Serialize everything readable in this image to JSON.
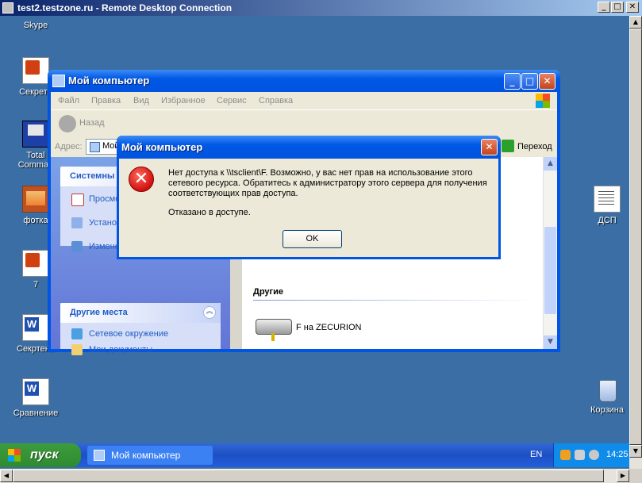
{
  "rdc": {
    "title": "test2.testzone.ru - Remote Desktop Connection",
    "min": "_",
    "max": "□",
    "close": "✕"
  },
  "desktop_icons": [
    {
      "label": "Skype"
    },
    {
      "label": "Секретн"
    },
    {
      "label": "Total Comman"
    },
    {
      "label": "фотка"
    },
    {
      "label": "7"
    },
    {
      "label": "Секртено"
    },
    {
      "label": "Сравнение"
    },
    {
      "label": "ДСП"
    },
    {
      "label": "Корзина"
    }
  ],
  "explorer": {
    "title": "Мой компьютер",
    "menu": [
      "Файл",
      "Правка",
      "Вид",
      "Избранное",
      "Сервис",
      "Справка"
    ],
    "back_label": "Назад",
    "address_label": "Адрес:",
    "address_value": "Мой",
    "go_label": "Переход",
    "system_tasks_title": "Системны",
    "system_tasks": [
      "Просмо систем",
      "Устано програ",
      "Изменение параметра"
    ],
    "other_places_title": "Другие места",
    "other_places": [
      "Сетевое окружение",
      "Мои документы"
    ],
    "section_title": "Другие",
    "drive_label": "F на ZECURION"
  },
  "dialog": {
    "title": "Мой компьютер",
    "message": "Нет доступа к \\\\tsclient\\F. Возможно, у вас нет прав на использование этого сетевого ресурса. Обратитесь к администратору этого сервера для получения соответствующих прав доступа.",
    "message2": "Отказано в доступе.",
    "ok_label": "OK",
    "close_label": "✕"
  },
  "taskbar": {
    "start_label": "пуск",
    "task_label": "Мой компьютер",
    "lang": "EN",
    "clock": "14:25"
  }
}
